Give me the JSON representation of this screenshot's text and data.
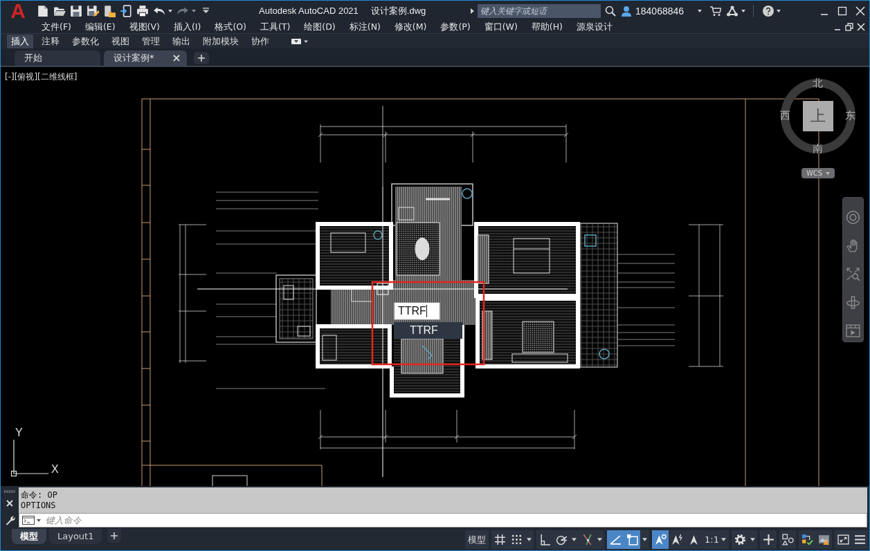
{
  "logo_text": "A",
  "quick_access": {
    "undo": {
      "disabled": false
    },
    "redo": {
      "disabled": true
    }
  },
  "window": {
    "title": "Autodesk AutoCAD 2021",
    "document": "设计案例.dwg"
  },
  "search": {
    "placeholder": "键入关键字或短语"
  },
  "user": {
    "name": "184068846"
  },
  "menu_bar": [
    "文件(F)",
    "编辑(E)",
    "视图(V)",
    "插入(I)",
    "格式(O)",
    "工具(T)",
    "绘图(D)",
    "标注(N)",
    "修改(M)",
    "参数(P)",
    "窗口(W)",
    "帮助(H)",
    "源泉设计"
  ],
  "ribbon_tabs": [
    {
      "label": "插入",
      "selected": true
    },
    {
      "label": "注释",
      "selected": false
    },
    {
      "label": "参数化",
      "selected": false
    },
    {
      "label": "视图",
      "selected": false
    },
    {
      "label": "管理",
      "selected": false
    },
    {
      "label": "输出",
      "selected": false
    },
    {
      "label": "附加模块",
      "selected": false
    },
    {
      "label": "协作",
      "selected": false
    }
  ],
  "file_tabs": [
    {
      "label": "开始",
      "selected": false
    },
    {
      "label": "设计案例*",
      "selected": true
    }
  ],
  "viewport": {
    "label": "[-][俯视][二维线框]"
  },
  "viewcube": {
    "north": "北",
    "west": "西",
    "east": "东",
    "south": "南",
    "face": "上",
    "coordinate_system": "WCS"
  },
  "ucs_icon": {
    "x_label": "X",
    "y_label": "Y"
  },
  "dynamic_input": {
    "value": "TTRF",
    "suggestions": [
      {
        "label": "TTRF",
        "selected": true
      }
    ]
  },
  "command_line": {
    "history": [
      "命令: OP",
      "OPTIONS"
    ],
    "placeholder": "键入命令"
  },
  "layout_tabs": [
    {
      "label": "模型",
      "selected": true
    },
    {
      "label": "Layout1",
      "selected": false
    }
  ],
  "status_bar": {
    "space_button": "模型",
    "toggles": [
      {
        "on": false
      },
      {
        "on": false
      },
      {
        "on": false
      },
      {
        "on": false
      },
      {
        "on": false
      },
      {
        "on": true
      },
      {
        "on": true
      },
      {
        "on": true
      },
      {
        "on": false
      }
    ],
    "annotation_scale": "1:1"
  }
}
